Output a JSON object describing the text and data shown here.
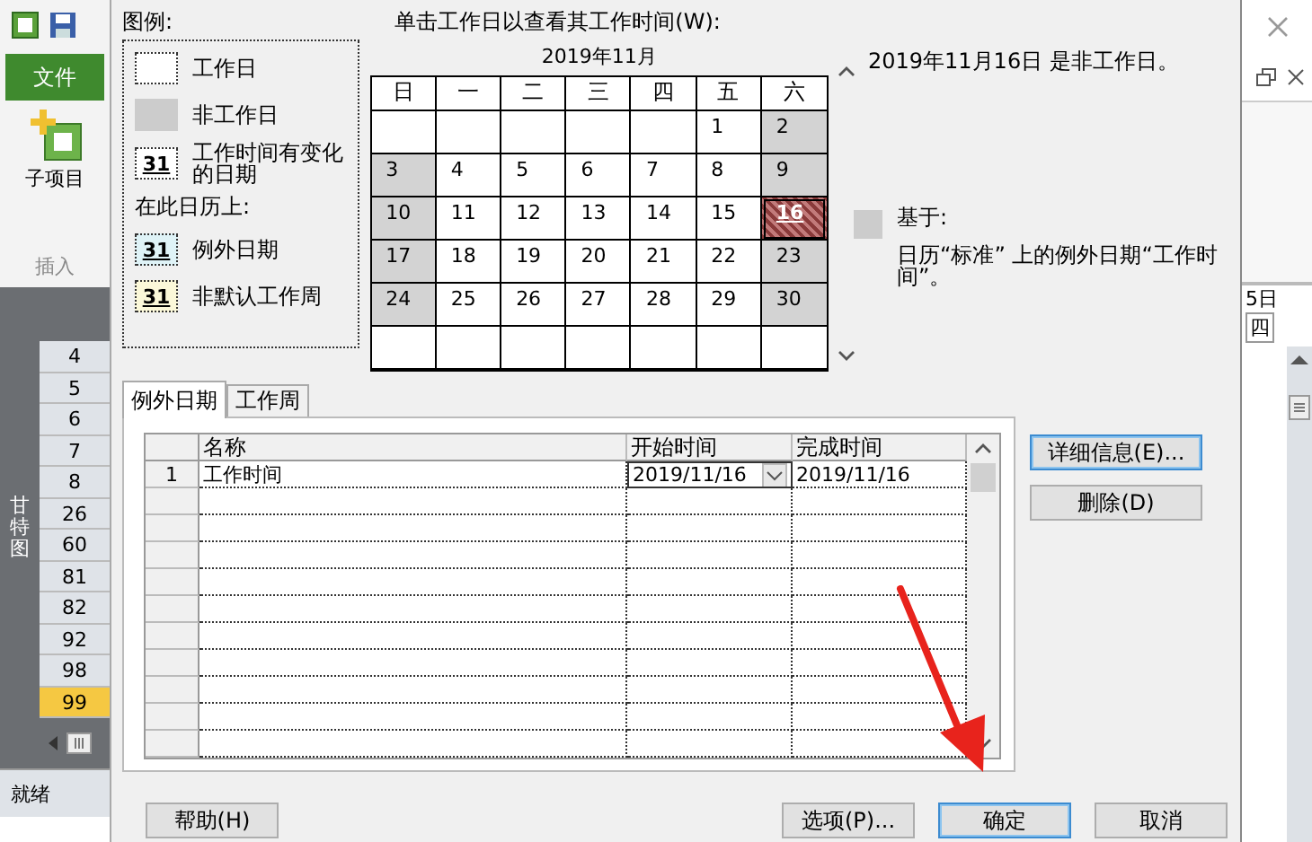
{
  "app_left": {
    "file_tab": "文件",
    "ribbon_button": "子项目",
    "ribbon_group": "插入",
    "view_label": "甘特图",
    "row_numbers": [
      {
        "label": "4",
        "selected": false
      },
      {
        "label": "5",
        "selected": false
      },
      {
        "label": "6",
        "selected": false
      },
      {
        "label": "7",
        "selected": false
      },
      {
        "label": "8",
        "selected": false
      },
      {
        "label": "26",
        "selected": false
      },
      {
        "label": "60",
        "selected": false
      },
      {
        "label": "81",
        "selected": false
      },
      {
        "label": "82",
        "selected": false
      },
      {
        "label": "92",
        "selected": false
      },
      {
        "label": "98",
        "selected": false
      },
      {
        "label": "99",
        "selected": true
      }
    ],
    "status": "就绪"
  },
  "app_right": {
    "timescale_top": "5日",
    "timescale_day": "四"
  },
  "dialog": {
    "legend": {
      "title": "图例:",
      "items": [
        {
          "kind": "working",
          "label": "工作日"
        },
        {
          "kind": "nonworking",
          "label": "非工作日"
        },
        {
          "kind": "changed",
          "swatch": "31",
          "label": "工作时间有变化的日期"
        },
        {
          "kind": "heading",
          "label": "在此日历上:"
        },
        {
          "kind": "exception",
          "swatch": "31",
          "label": "例外日期"
        },
        {
          "kind": "nondefault",
          "swatch": "31",
          "label": "非默认工作周"
        }
      ]
    },
    "calendar": {
      "prompt": "单击工作日以查看其工作时间(W):",
      "month": "2019年11月",
      "weekdays": [
        "日",
        "一",
        "二",
        "三",
        "四",
        "五",
        "六"
      ],
      "weeks": [
        [
          {
            "kind": "blank"
          },
          {
            "kind": "blank"
          },
          {
            "kind": "blank"
          },
          {
            "kind": "blank"
          },
          {
            "kind": "blank"
          },
          {
            "kind": "working",
            "day": "1",
            "selected": false
          },
          {
            "kind": "nonworking",
            "day": "2",
            "selected": false
          }
        ],
        [
          {
            "kind": "nonworking",
            "day": "3",
            "selected": false
          },
          {
            "kind": "working",
            "day": "4",
            "selected": false
          },
          {
            "kind": "working",
            "day": "5",
            "selected": false
          },
          {
            "kind": "working",
            "day": "6",
            "selected": false
          },
          {
            "kind": "working",
            "day": "7",
            "selected": false
          },
          {
            "kind": "working",
            "day": "8",
            "selected": false
          },
          {
            "kind": "nonworking",
            "day": "9",
            "selected": false
          }
        ],
        [
          {
            "kind": "nonworking",
            "day": "10",
            "selected": false
          },
          {
            "kind": "working",
            "day": "11",
            "selected": false
          },
          {
            "kind": "working",
            "day": "12",
            "selected": false
          },
          {
            "kind": "working",
            "day": "13",
            "selected": false
          },
          {
            "kind": "working",
            "day": "14",
            "selected": false
          },
          {
            "kind": "working",
            "day": "15",
            "selected": false
          },
          {
            "kind": "exception",
            "day": "16",
            "selected": true
          }
        ],
        [
          {
            "kind": "nonworking",
            "day": "17",
            "selected": false
          },
          {
            "kind": "working",
            "day": "18",
            "selected": false
          },
          {
            "kind": "working",
            "day": "19",
            "selected": false
          },
          {
            "kind": "working",
            "day": "20",
            "selected": false
          },
          {
            "kind": "working",
            "day": "21",
            "selected": false
          },
          {
            "kind": "working",
            "day": "22",
            "selected": false
          },
          {
            "kind": "nonworking",
            "day": "23",
            "selected": false
          }
        ],
        [
          {
            "kind": "nonworking",
            "day": "24",
            "selected": false
          },
          {
            "kind": "working",
            "day": "25",
            "selected": false
          },
          {
            "kind": "working",
            "day": "26",
            "selected": false
          },
          {
            "kind": "working",
            "day": "27",
            "selected": false
          },
          {
            "kind": "working",
            "day": "28",
            "selected": false
          },
          {
            "kind": "working",
            "day": "29",
            "selected": false
          },
          {
            "kind": "nonworking",
            "day": "30",
            "selected": false
          }
        ],
        [
          {
            "kind": "blank"
          },
          {
            "kind": "blank"
          },
          {
            "kind": "blank"
          },
          {
            "kind": "blank"
          },
          {
            "kind": "blank"
          },
          {
            "kind": "blank"
          },
          {
            "kind": "blank"
          }
        ]
      ]
    },
    "info": {
      "status": "2019年11月16日 是非工作日。",
      "based_on_label": "基于:",
      "based_on_text": "日历“标准” 上的例外日期“工作时间”。"
    },
    "tabs": [
      {
        "label": "例外日期",
        "selected": true
      },
      {
        "label": "工作周",
        "selected": false
      }
    ],
    "table": {
      "columns": [
        "名称",
        "开始时间",
        "完成时间"
      ],
      "rows": [
        {
          "number": "1",
          "name": "工作时间",
          "start": "2019/11/16",
          "finish": "2019/11/16",
          "editing": true
        }
      ]
    },
    "side_buttons": [
      {
        "label": "详细信息(E)...",
        "default": true
      },
      {
        "label": "删除(D)",
        "default": false
      }
    ],
    "buttons": [
      {
        "label": "帮助(H)",
        "default": false
      },
      {
        "label": "选项(P)...",
        "default": false
      },
      {
        "label": "确定",
        "default": true
      },
      {
        "label": "取消",
        "default": false
      }
    ]
  }
}
